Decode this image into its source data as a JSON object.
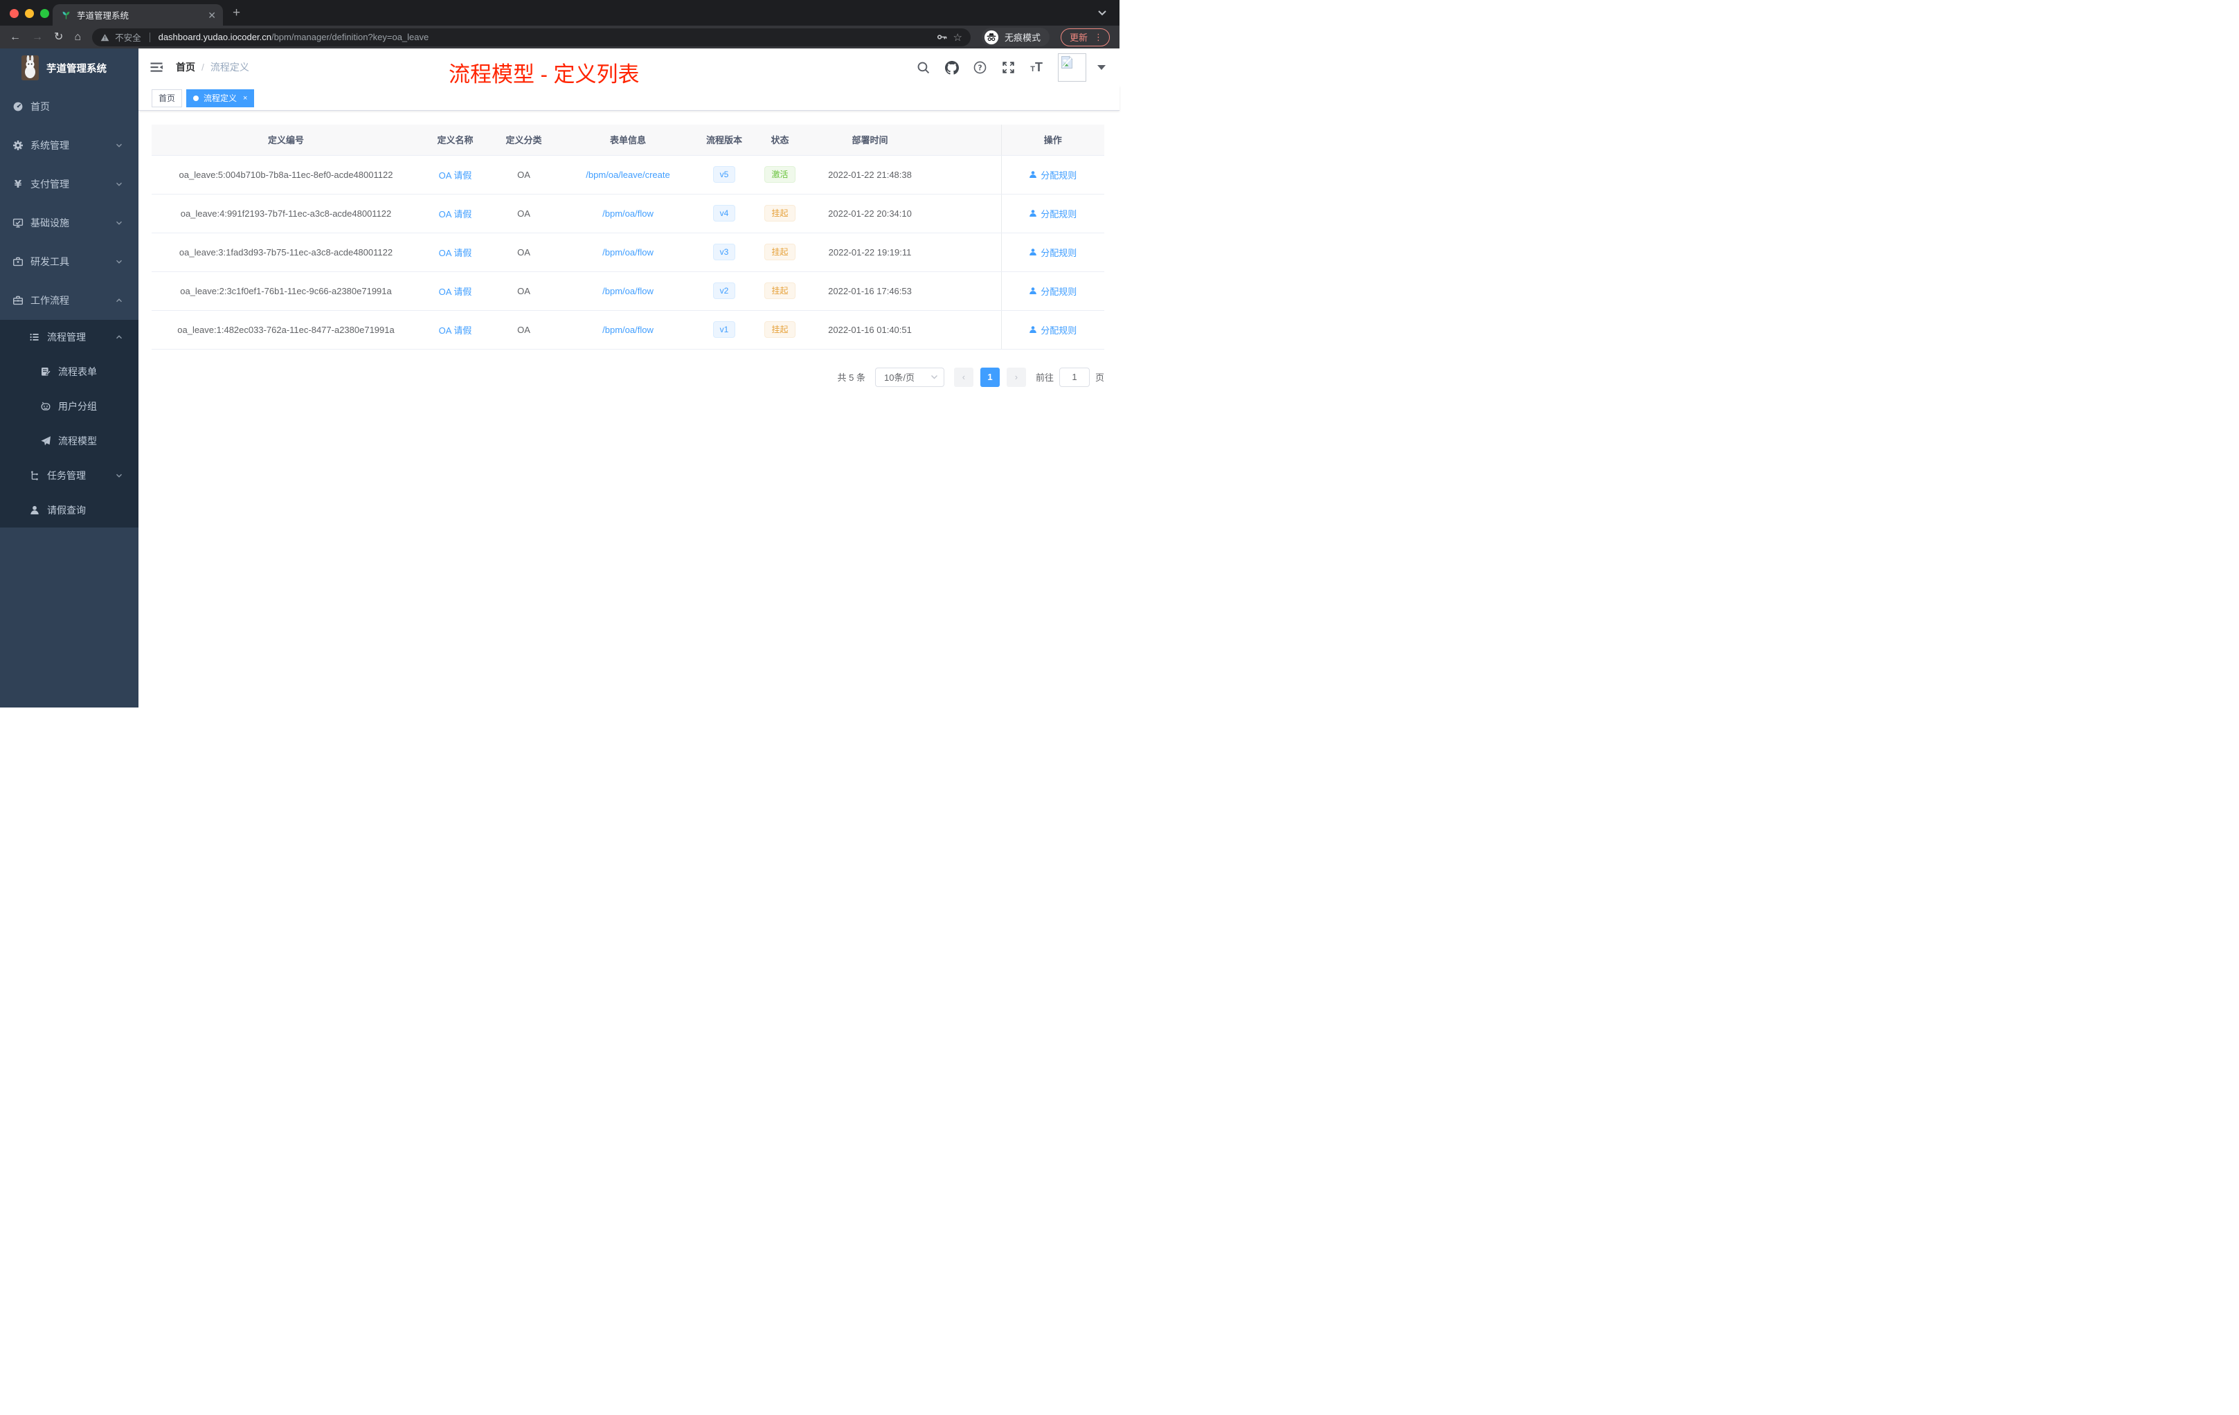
{
  "browser": {
    "tab_title": "芋道管理系统",
    "new_tab_label": "+",
    "close_tab_label": "✕",
    "security_label": "不安全",
    "url_host": "dashboard.yudao.iocoder.cn",
    "url_path": "/bpm/manager/definition?key=oa_leave",
    "incognito_label": "无痕模式",
    "update_label": "更新",
    "menu_dots": "⋮",
    "back": "←",
    "forward": "→",
    "reload": "↻",
    "home": "⌂",
    "star": "☆"
  },
  "annotation": {
    "title": "流程模型 - 定义列表"
  },
  "sidebar": {
    "app_title": "芋道管理系统",
    "items": [
      {
        "label": "首页",
        "icon": "dashboard-icon"
      },
      {
        "label": "系统管理",
        "icon": "gear-icon",
        "chevron": "down"
      },
      {
        "label": "支付管理",
        "icon": "yen-icon",
        "chevron": "down"
      },
      {
        "label": "基础设施",
        "icon": "monitor-icon",
        "chevron": "down"
      },
      {
        "label": "研发工具",
        "icon": "toolbox-icon",
        "chevron": "down"
      },
      {
        "label": "工作流程",
        "icon": "briefcase-icon",
        "chevron": "up"
      }
    ],
    "submenu": [
      {
        "label": "流程管理",
        "icon": "list-tree-icon",
        "chevron": "up",
        "level": 1
      },
      {
        "label": "流程表单",
        "icon": "form-edit-icon",
        "level": 2
      },
      {
        "label": "用户分组",
        "icon": "user-group-icon",
        "level": 2
      },
      {
        "label": "流程模型",
        "icon": "paper-plane-icon",
        "level": 2
      },
      {
        "label": "任务管理",
        "icon": "task-tree-icon",
        "chevron": "down",
        "level": 1
      },
      {
        "label": "请假查询",
        "icon": "person-icon",
        "level": 1
      }
    ]
  },
  "header": {
    "breadcrumb": [
      "首页",
      "流程定义"
    ],
    "breadcrumb_separator": "/",
    "icons": [
      "search-icon",
      "github-icon",
      "help-icon",
      "fullscreen-icon",
      "text-size-icon",
      "avatar",
      "caret-down-icon"
    ]
  },
  "tags": [
    {
      "label": "首页",
      "active": false
    },
    {
      "label": "流程定义",
      "active": true,
      "closable": true,
      "close_label": "×"
    }
  ],
  "table": {
    "columns": [
      "定义编号",
      "定义名称",
      "定义分类",
      "表单信息",
      "流程版本",
      "状态",
      "部署时间",
      "操作"
    ],
    "action_label": "分配规则",
    "rows": [
      {
        "id": "oa_leave:5:004b710b-7b8a-11ec-8ef0-acde48001122",
        "name": "OA 请假",
        "category": "OA",
        "form": "/bpm/oa/leave/create",
        "version": "v5",
        "status": "激活",
        "status_type": "success",
        "deploy_time": "2022-01-22 21:48:38"
      },
      {
        "id": "oa_leave:4:991f2193-7b7f-11ec-a3c8-acde48001122",
        "name": "OA 请假",
        "category": "OA",
        "form": "/bpm/oa/flow",
        "version": "v4",
        "status": "挂起",
        "status_type": "warning",
        "deploy_time": "2022-01-22 20:34:10"
      },
      {
        "id": "oa_leave:3:1fad3d93-7b75-11ec-a3c8-acde48001122",
        "name": "OA 请假",
        "category": "OA",
        "form": "/bpm/oa/flow",
        "version": "v3",
        "status": "挂起",
        "status_type": "warning",
        "deploy_time": "2022-01-22 19:19:11"
      },
      {
        "id": "oa_leave:2:3c1f0ef1-76b1-11ec-9c66-a2380e71991a",
        "name": "OA 请假",
        "category": "OA",
        "form": "/bpm/oa/flow",
        "version": "v2",
        "status": "挂起",
        "status_type": "warning",
        "deploy_time": "2022-01-16 17:46:53"
      },
      {
        "id": "oa_leave:1:482ec033-762a-11ec-8477-a2380e71991a",
        "name": "OA 请假",
        "category": "OA",
        "form": "/bpm/oa/flow",
        "version": "v1",
        "status": "挂起",
        "status_type": "warning",
        "deploy_time": "2022-01-16 01:40:51"
      }
    ]
  },
  "pagination": {
    "total_label": "共 5 条",
    "page_size": "10条/页",
    "prev": "‹",
    "next": "›",
    "current_page": "1",
    "goto_label": "前往",
    "goto_value": "1",
    "page_unit": "页"
  },
  "colors": {
    "accent": "#409eff",
    "annotation_red": "#ff2400",
    "sidebar_bg": "#304156",
    "submenu_bg": "#1f2d3d",
    "status_active_green": "#67c23a",
    "status_suspended_orange": "#e6a23c",
    "version_blue": "#409eff"
  }
}
